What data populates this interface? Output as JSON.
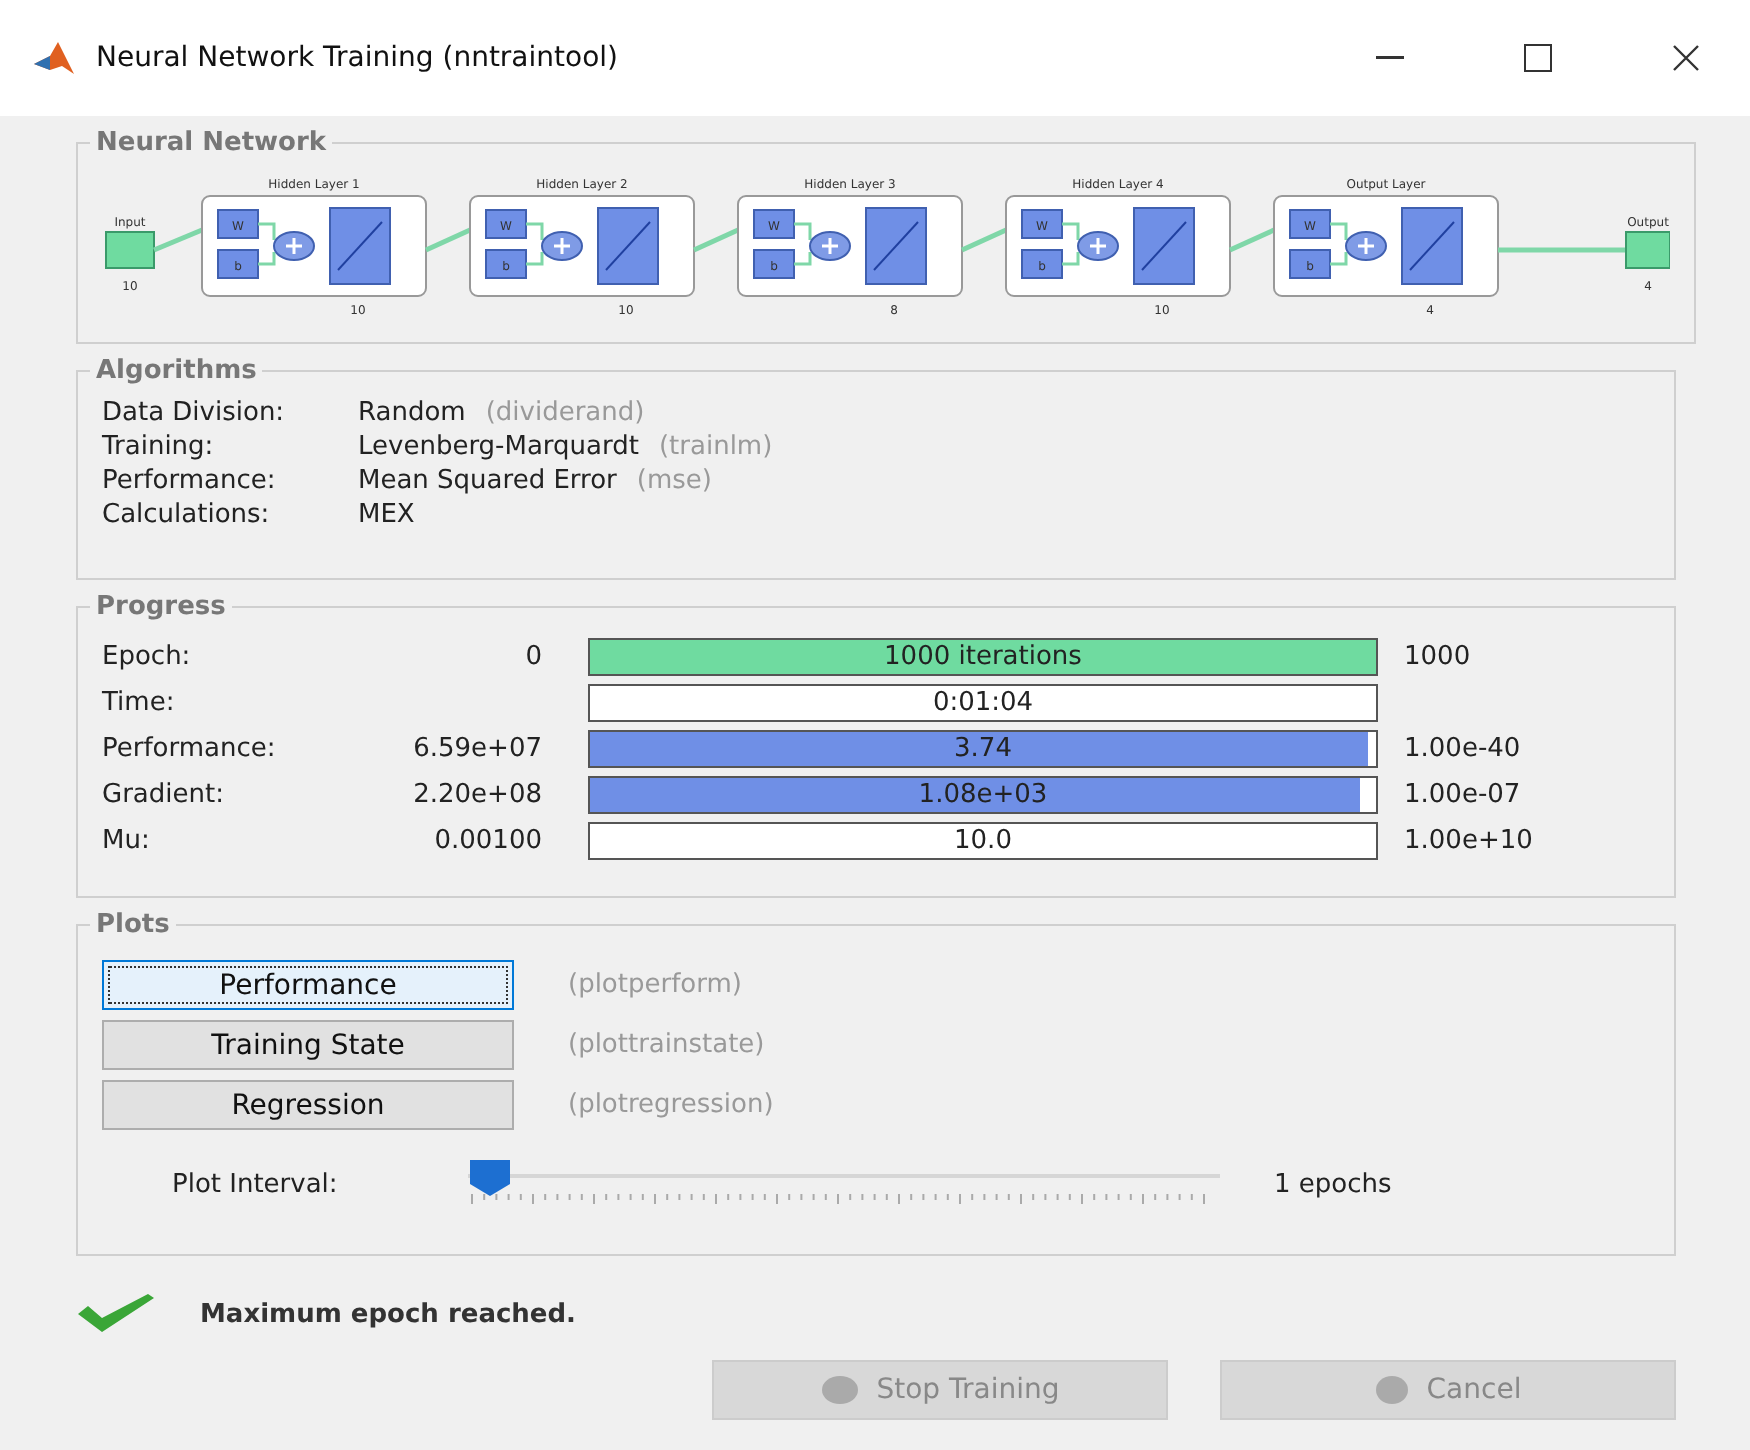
{
  "window": {
    "title": "Neural Network Training (nntraintool)"
  },
  "network": {
    "title": "Neural Network",
    "input": {
      "label": "Input",
      "size": "10"
    },
    "layers": [
      {
        "label": "Hidden Layer 1",
        "size": "10",
        "weight": "W",
        "bias": "b"
      },
      {
        "label": "Hidden Layer 2",
        "size": "10",
        "weight": "W",
        "bias": "b"
      },
      {
        "label": "Hidden Layer 3",
        "size": "8",
        "weight": "W",
        "bias": "b"
      },
      {
        "label": "Hidden Layer 4",
        "size": "10",
        "weight": "W",
        "bias": "b"
      },
      {
        "label": "Output Layer",
        "size": "4",
        "weight": "W",
        "bias": "b"
      }
    ],
    "output": {
      "label": "Output",
      "size": "4"
    }
  },
  "algorithms": {
    "title": "Algorithms",
    "rows": [
      {
        "label": "Data Division:",
        "value": "Random",
        "function": "(dividerand)"
      },
      {
        "label": "Training:",
        "value": "Levenberg-Marquardt",
        "function": "(trainlm)"
      },
      {
        "label": "Performance:",
        "value": "Mean Squared Error",
        "function": "(mse)"
      },
      {
        "label": "Calculations:",
        "value": "MEX"
      }
    ]
  },
  "progress": {
    "title": "Progress",
    "rows": [
      {
        "label": "Epoch:",
        "start": "0",
        "reading": "1000 iterations",
        "end": "1000",
        "level": 1,
        "color": "#6fdba0"
      },
      {
        "label": "Time:",
        "reading": "0:01:04"
      },
      {
        "label": "Performance:",
        "start": "6.59e+07",
        "reading": "3.74",
        "end": "1.00e-40",
        "level": 0.99,
        "color": "#6f8fe6"
      },
      {
        "label": "Gradient:",
        "start": "2.20e+08",
        "reading": "1.08e+03",
        "end": "1.00e-07",
        "level": 0.98,
        "color": "#6f8fe6"
      },
      {
        "label": "Mu:",
        "start": "0.00100",
        "reading": "10.0",
        "end": "1.00e+10"
      }
    ]
  },
  "plots": {
    "title": "Plots",
    "buttons": [
      {
        "label": "Performance",
        "function": "(plotperform)",
        "focused": true
      },
      {
        "label": "Training State",
        "function": "(plottrainstate)",
        "focused": false
      },
      {
        "label": "Regression",
        "function": "(plotregression)",
        "focused": false
      }
    ],
    "interval": {
      "label": "Plot Interval:",
      "level": 0,
      "reading": "1 epochs"
    }
  },
  "status": {
    "message": "Maximum epoch reached.",
    "kind": "success"
  },
  "buttons": [
    {
      "label": "Stop Training",
      "kind": "stop",
      "disabled": true
    },
    {
      "label": "Cancel",
      "kind": "cancel",
      "disabled": true
    }
  ]
}
